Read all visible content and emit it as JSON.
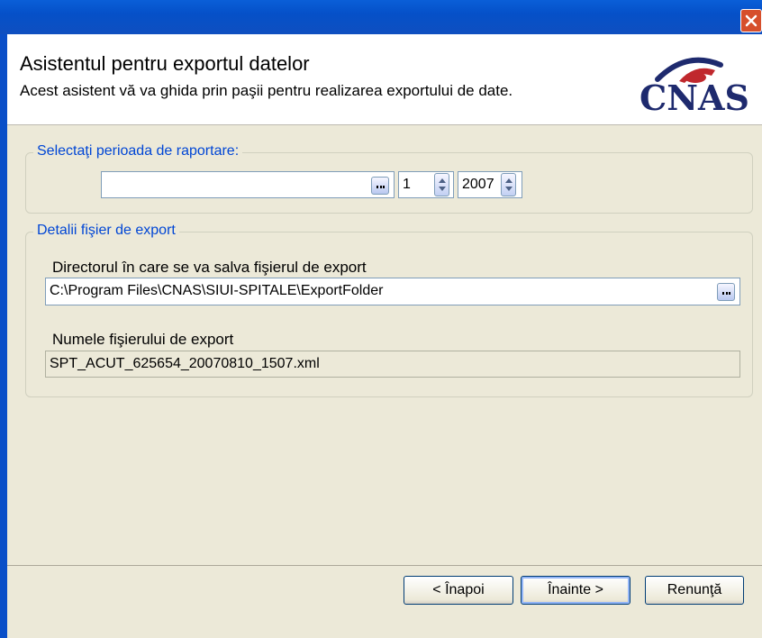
{
  "dialog": {
    "title": "Asistentul pentru exportul datelor",
    "subtitle": "Acest asistent vă va ghida prin paşii pentru realizarea exportului de date.",
    "logo_text": "CNAS"
  },
  "period_group": {
    "legend": "Selectaţi perioada de raportare:",
    "period_value": "",
    "month_value": "1",
    "year_value": "2007"
  },
  "export_group": {
    "legend": "Detalii fişier de export",
    "directory_label": "Directorul în care se va salva fişierul de export",
    "directory_value": "C:\\Program Files\\CNAS\\SIUI-SPITALE\\ExportFolder",
    "filename_label": "Numele fişierului de export",
    "filename_value": "SPT_ACUT_625654_20070810_1507.xml"
  },
  "buttons": {
    "back": "< Înapoi",
    "next": "Înainte >",
    "cancel": "Renunţă"
  },
  "colors": {
    "titlebar": "#0a5fd8",
    "accent_blue": "#0046d5",
    "dialog_bg": "#ece9d8",
    "logo_red": "#c0282d",
    "logo_navy": "#1e2a6e"
  }
}
